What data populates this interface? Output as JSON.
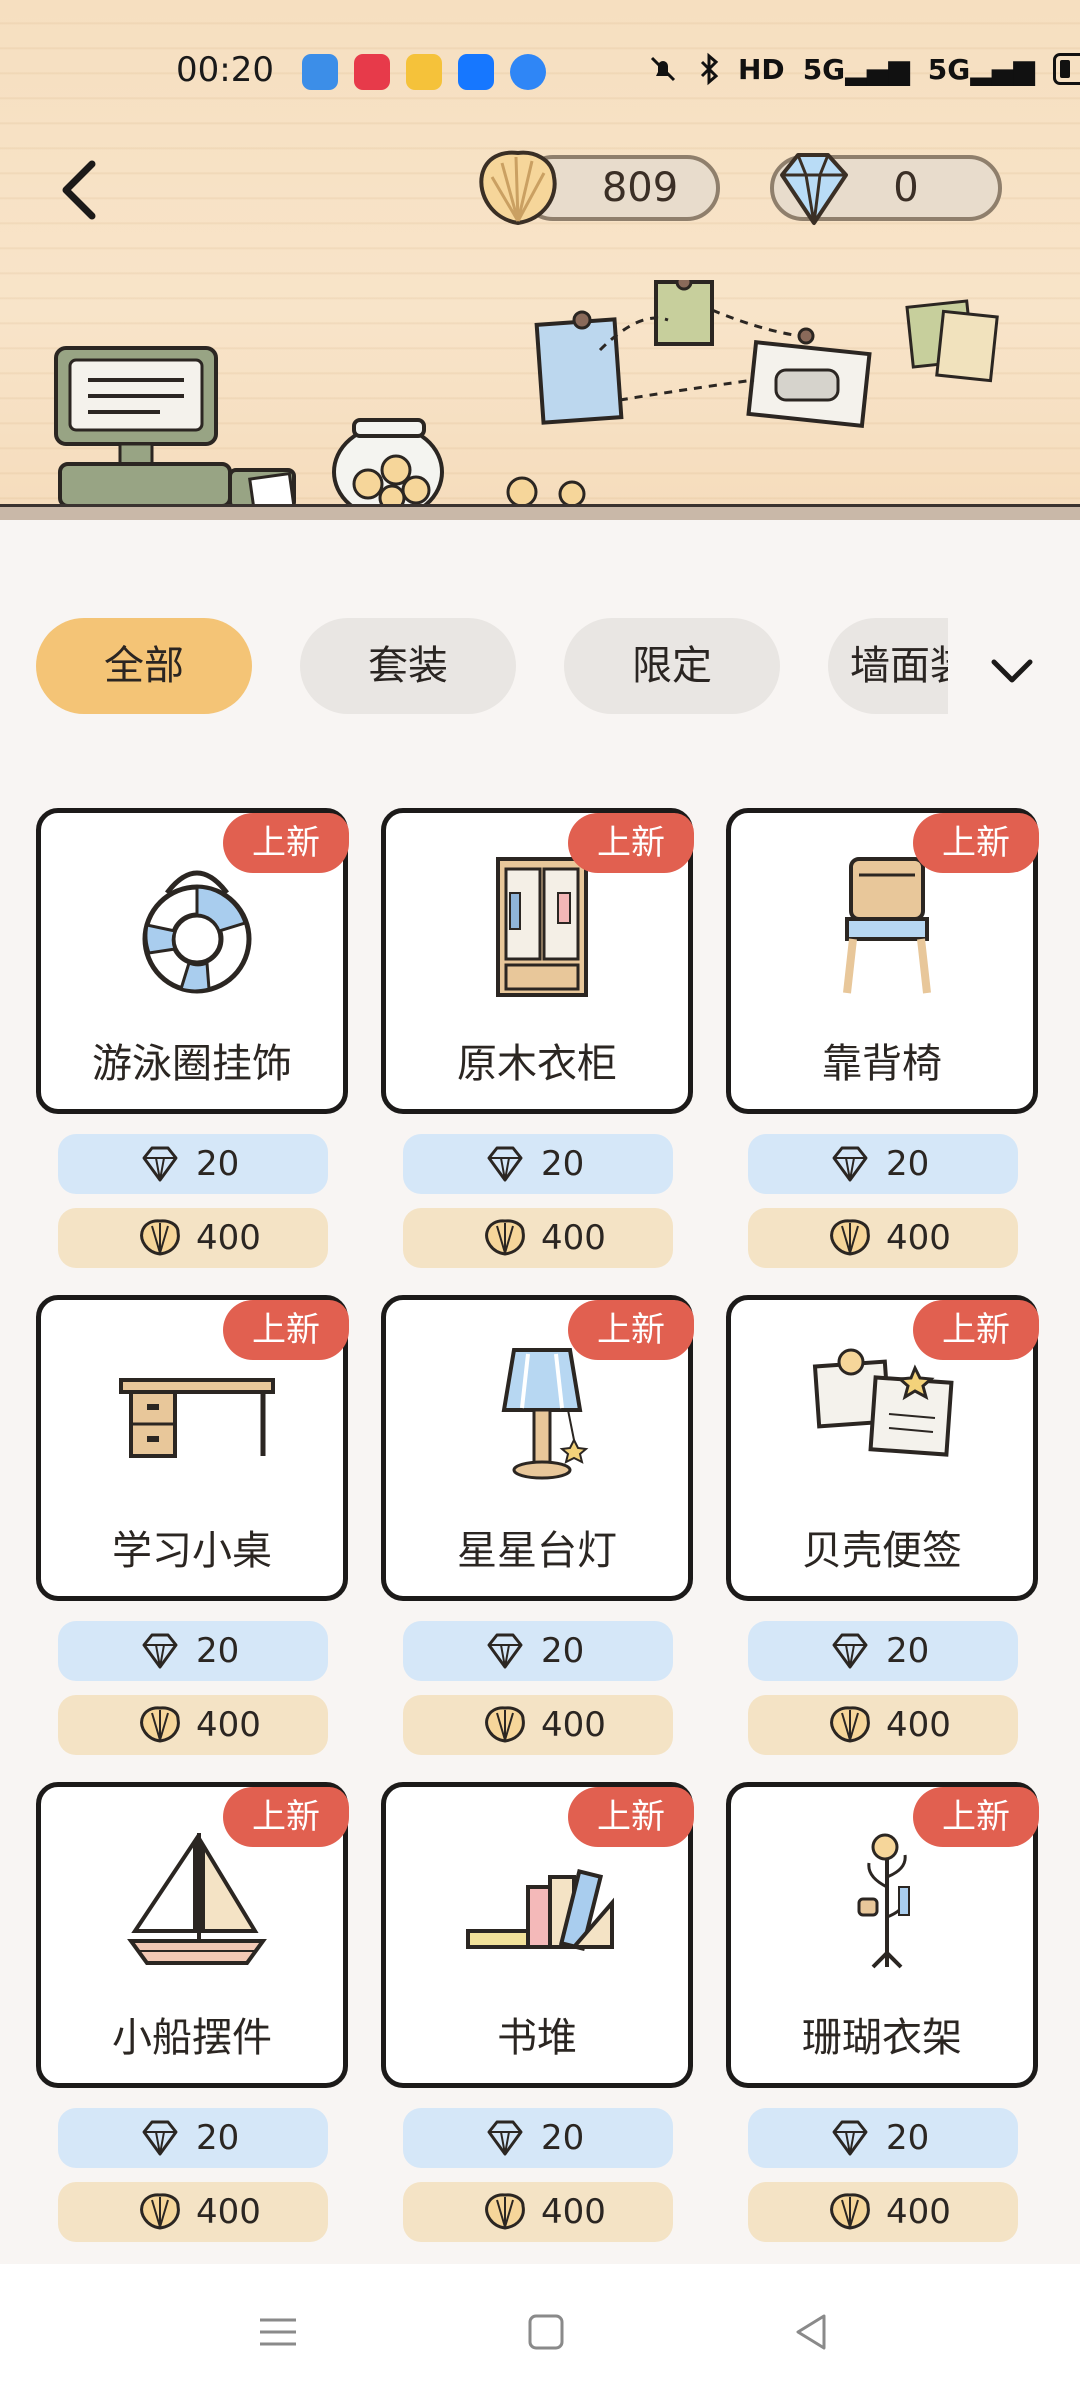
{
  "status_bar": {
    "time": "00:20",
    "indicators": [
      "HD",
      "5G",
      "5G"
    ],
    "notification_apps": [
      "weather-app",
      "video-app",
      "weibo-app",
      "alipay-app",
      "messenger-app"
    ]
  },
  "header": {
    "shells_balance": "809",
    "gems_balance": "0"
  },
  "tabs": [
    {
      "label": "全部",
      "active": true
    },
    {
      "label": "套装",
      "active": false
    },
    {
      "label": "限定",
      "active": false
    },
    {
      "label": "墙面装",
      "active": false
    }
  ],
  "items": [
    {
      "name": "游泳圈挂饰",
      "badge": "上新",
      "gem_price": "20",
      "shell_price": "400",
      "icon": "swim-ring"
    },
    {
      "name": "原木衣柜",
      "badge": "上新",
      "gem_price": "20",
      "shell_price": "400",
      "icon": "wardrobe"
    },
    {
      "name": "靠背椅",
      "badge": "上新",
      "gem_price": "20",
      "shell_price": "400",
      "icon": "chair"
    },
    {
      "name": "学习小桌",
      "badge": "上新",
      "gem_price": "20",
      "shell_price": "400",
      "icon": "desk"
    },
    {
      "name": "星星台灯",
      "badge": "上新",
      "gem_price": "20",
      "shell_price": "400",
      "icon": "star-lamp"
    },
    {
      "name": "贝壳便签",
      "badge": "上新",
      "gem_price": "20",
      "shell_price": "400",
      "icon": "shell-notes"
    },
    {
      "name": "小船摆件",
      "badge": "上新",
      "gem_price": "20",
      "shell_price": "400",
      "icon": "sailboat"
    },
    {
      "name": "书堆",
      "badge": "上新",
      "gem_price": "20",
      "shell_price": "400",
      "icon": "book-stack"
    },
    {
      "name": "珊瑚衣架",
      "badge": "上新",
      "gem_price": "20",
      "shell_price": "400",
      "icon": "coat-rack"
    }
  ],
  "colors": {
    "active_tab": "#f4c476",
    "badge": "#e16050",
    "gem_pill": "#d5e7f8",
    "shell_pill": "#f4e3c5"
  }
}
